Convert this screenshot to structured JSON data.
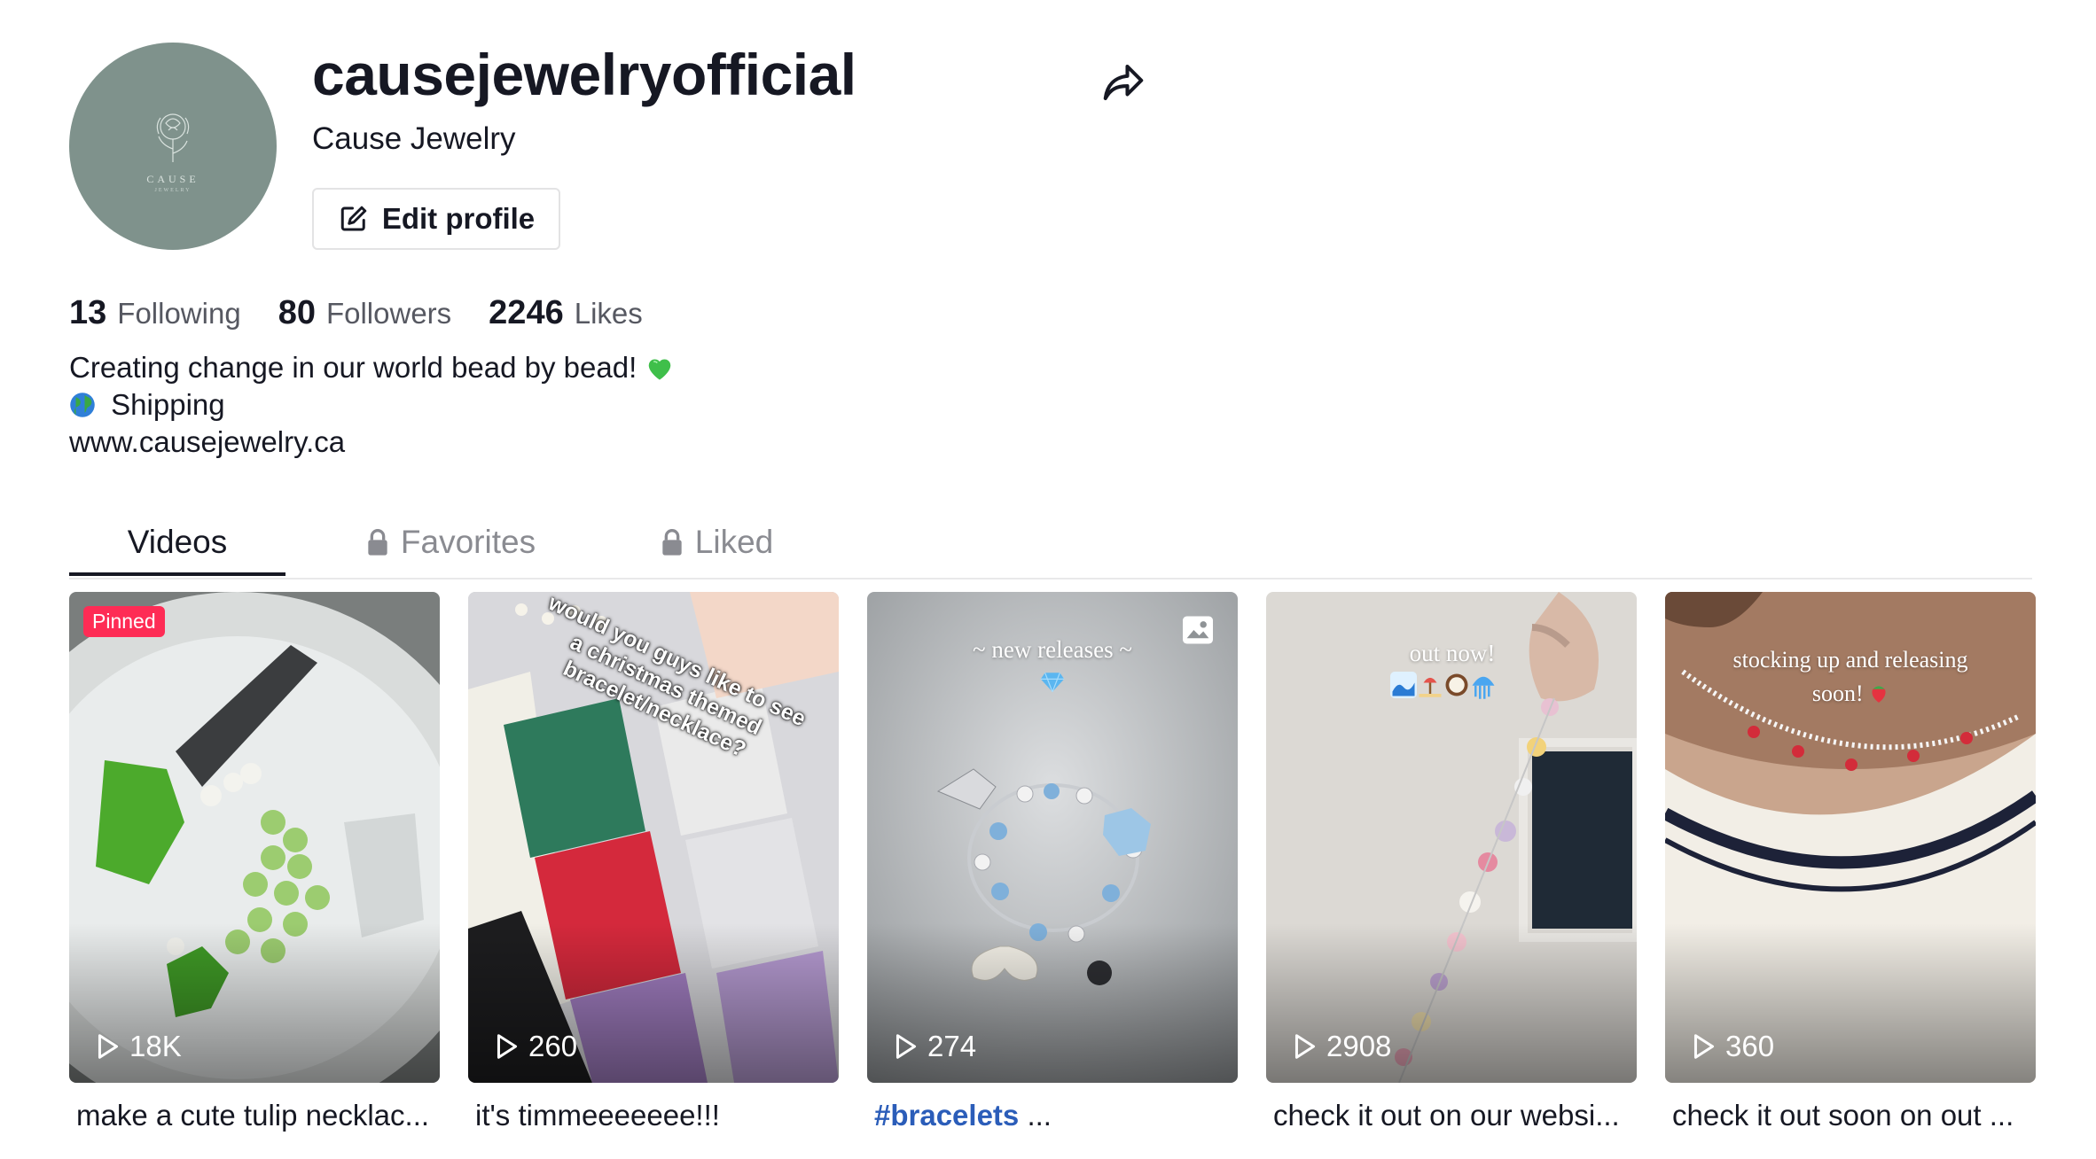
{
  "profile": {
    "username": "causejewelryofficial",
    "nickname": "Cause Jewelry",
    "edit_label": "Edit profile",
    "avatar_text": "CAUSE",
    "avatar_subtext": "JEWELRY"
  },
  "stats": {
    "following_count": "13",
    "following_label": "Following",
    "followers_count": "80",
    "followers_label": "Followers",
    "likes_count": "2246",
    "likes_label": "Likes"
  },
  "bio": {
    "line1": "Creating change in our world bead by bead!",
    "line2": "Shipping",
    "link": "www.causejewelry.ca"
  },
  "tabs": [
    {
      "label": "Videos",
      "active": true,
      "locked": false
    },
    {
      "label": "Favorites",
      "active": false,
      "locked": true
    },
    {
      "label": "Liked",
      "active": false,
      "locked": true
    }
  ],
  "videos": [
    {
      "views": "18K",
      "caption": "make a cute tulip necklac...",
      "pinned_label": "Pinned",
      "overlay": ""
    },
    {
      "views": "260",
      "caption": "it's timmeeeeeee!!!",
      "overlay": "would you guys like to see a christmas themed bracelet/necklace?"
    },
    {
      "views": "274",
      "caption_tag": "#bracelets",
      "caption_rest": " ...",
      "overlay": "~ new releases ~"
    },
    {
      "views": "2908",
      "caption": "check it out on our websi...",
      "overlay": "out now!"
    },
    {
      "views": "360",
      "caption": "check it out soon on out ...",
      "overlay_line1": "stocking up and releasing",
      "overlay_line2": "soon!"
    }
  ],
  "colors": {
    "accent": "#fe2c55",
    "link": "#2b5db9",
    "text": "#161823",
    "muted": "#565861"
  }
}
